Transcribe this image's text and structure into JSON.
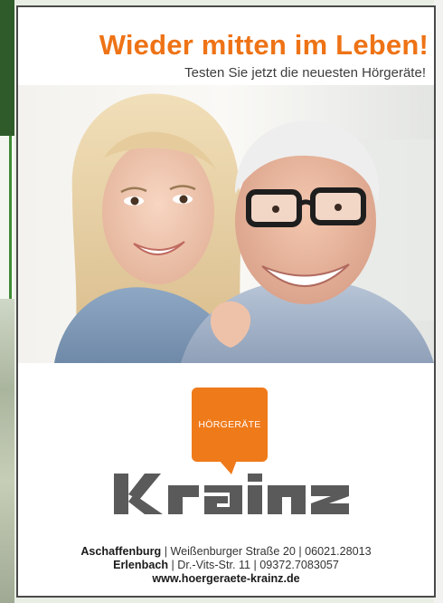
{
  "ad": {
    "headline": "Wieder mitten im Leben!",
    "subline": "Testen Sie jetzt die neuesten Hörgeräte!",
    "logo": {
      "badge_text": "HÖRGERÄTE",
      "wordmark": "krainz"
    },
    "locations": [
      {
        "city": "Aschaffenburg",
        "street": "Weißenburger Straße 20",
        "phone": "06021.28013"
      },
      {
        "city": "Erlenbach",
        "street": "Dr.-Vits-Str. 11",
        "phone": "09372.7083057"
      }
    ],
    "website": "www.hoergeraete-krainz.de"
  },
  "colors": {
    "brand_orange": "#ee7316",
    "brand_grey": "#5a5a5a",
    "frame": "#4a4a4a"
  }
}
